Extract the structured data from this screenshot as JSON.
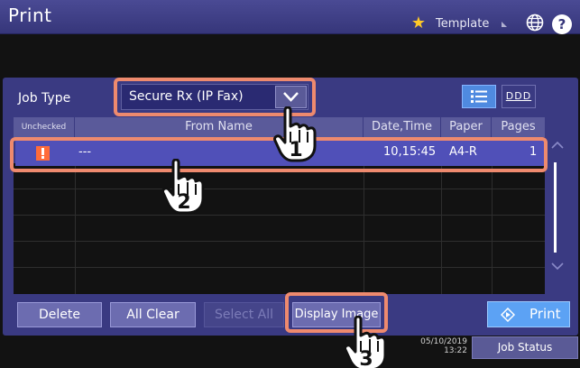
{
  "title": "Print",
  "header": {
    "template_label": "Template",
    "help_label": "?"
  },
  "job_type": {
    "label": "Job Type",
    "value": "Secure Rx (IP Fax)"
  },
  "view_toggle": {
    "thumbnail_label": "DDD"
  },
  "table": {
    "columns": [
      "Unchecked",
      "From Name",
      "Date,Time",
      "Paper",
      "Pages"
    ],
    "rows": [
      {
        "from_name": "---",
        "date_time": "10,15:45",
        "paper": "A4-R",
        "pages": "1"
      }
    ]
  },
  "buttons": {
    "delete": "Delete",
    "all_clear": "All Clear",
    "select_all": "Select All",
    "display_image": "Display Image",
    "print": "Print"
  },
  "status": {
    "date": "05/10/2019",
    "time": "13:22",
    "job_status": "Job Status"
  },
  "steps": [
    "1",
    "2",
    "3"
  ],
  "colors": {
    "titlebar": "#36367a",
    "panel": "#3a3a82",
    "selected_row": "#5050b8",
    "highlight": "#ee8a6e",
    "print_button": "#5ca2f4",
    "warning": "#ff6b3a"
  }
}
